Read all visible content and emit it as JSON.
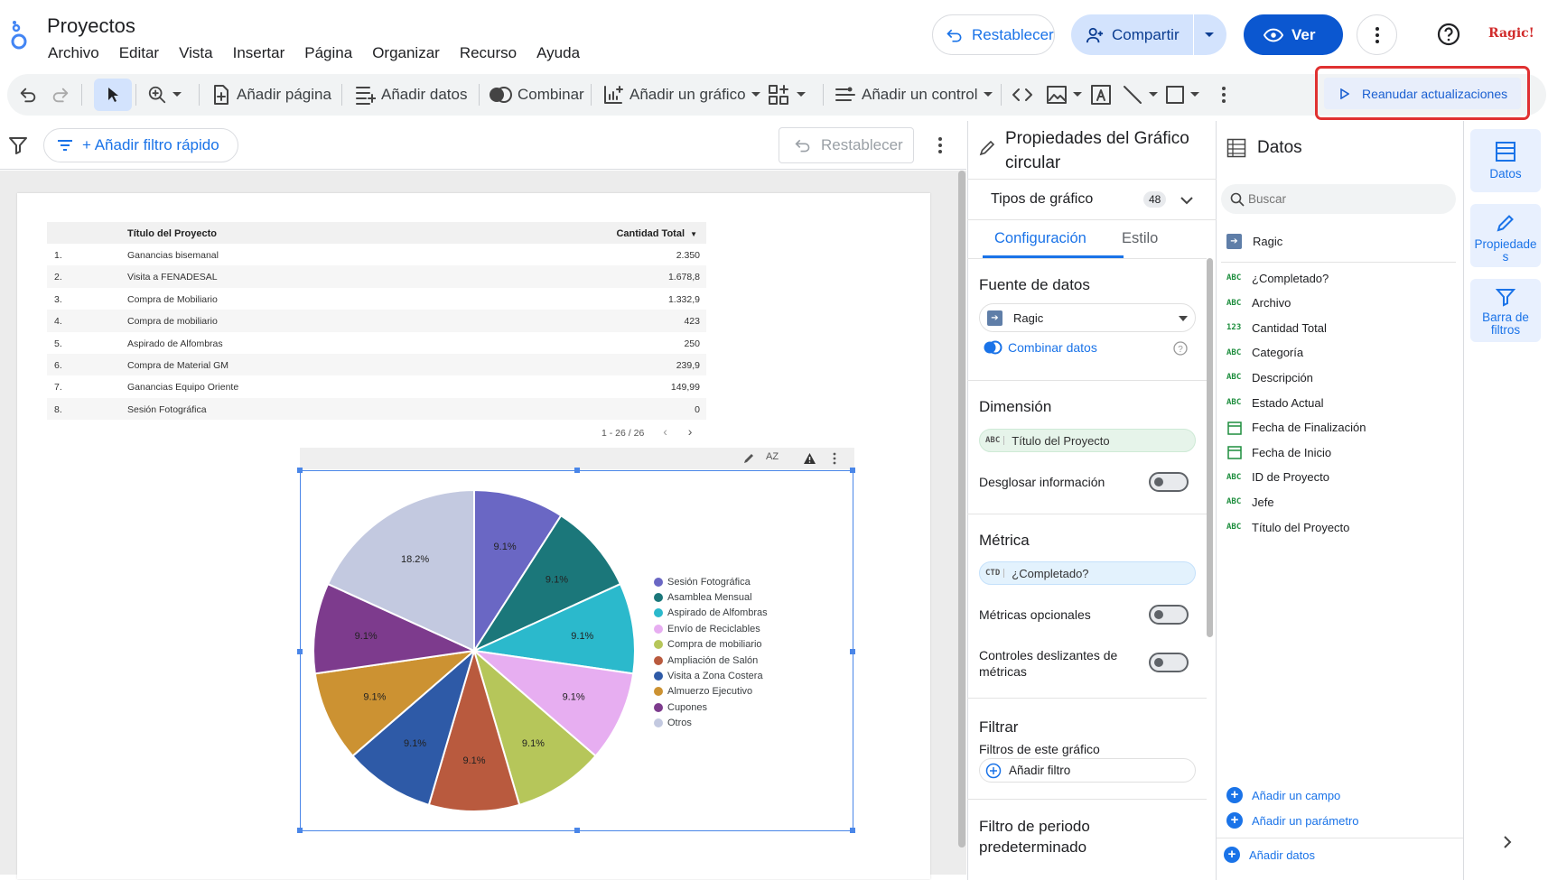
{
  "app": {
    "title": "Proyectos",
    "menu": [
      "Archivo",
      "Editar",
      "Vista",
      "Insertar",
      "Página",
      "Organizar",
      "Recurso",
      "Ayuda"
    ],
    "reset_label": "Restablecer",
    "share_label": "Compartir",
    "view_label": "Ver",
    "brand": "Ragic!"
  },
  "toolbar": {
    "add_page": "Añadir página",
    "add_data": "Añadir datos",
    "blend": "Combinar",
    "add_chart": "Añadir un gráfico",
    "add_control": "Añadir un control",
    "resume_updates": "Reanudar actualizaciones"
  },
  "filterbar": {
    "quick_filter": "+ Añadir filtro rápido",
    "reset": "Restablecer"
  },
  "table": {
    "headers": [
      "Título del Proyecto",
      "Cantidad Total"
    ],
    "rows": [
      {
        "n": "1.",
        "title": "Ganancias bisemanal",
        "value": "2.350"
      },
      {
        "n": "2.",
        "title": "Visita a FENADESAL",
        "value": "1.678,8"
      },
      {
        "n": "3.",
        "title": "Compra de Mobiliario",
        "value": "1.332,9"
      },
      {
        "n": "4.",
        "title": "Compra de mobiliario",
        "value": "423"
      },
      {
        "n": "5.",
        "title": "Aspirado de Alfombras",
        "value": "250"
      },
      {
        "n": "6.",
        "title": "Compra de Material GM",
        "value": "239,9"
      },
      {
        "n": "7.",
        "title": "Ganancias Equipo Oriente",
        "value": "149,99"
      },
      {
        "n": "8.",
        "title": "Sesión Fotográfica",
        "value": "0"
      }
    ],
    "pagination": "1 - 26 / 26"
  },
  "chart_data": {
    "type": "pie",
    "categories": [
      "Sesión Fotográfica",
      "Asamblea Mensual",
      "Aspirado de Alfombras",
      "Envío de Reciclables",
      "Compra de mobiliario",
      "Ampliación de Salón",
      "Visita a Zona Costera",
      "Almuerzo Ejecutivo",
      "Cupones",
      "Otros"
    ],
    "values": [
      9.1,
      9.1,
      9.1,
      9.1,
      9.1,
      9.1,
      9.1,
      9.1,
      9.1,
      18.2
    ],
    "labels": [
      "9.1%",
      "9.1%",
      "9.1%",
      "9.1%",
      "9.1%",
      "9.1%",
      "9.1%",
      "9.1%",
      "9.1%",
      "18.2%"
    ],
    "colors": [
      "#6a67c4",
      "#1b777a",
      "#2bb9cc",
      "#e7aef1",
      "#b6c65a",
      "#b95a3e",
      "#2e5aa7",
      "#cc9232",
      "#7d3b8d",
      "#c3c9e0"
    ],
    "legend_position": "right",
    "title": ""
  },
  "properties": {
    "title": "Propiedades del Gráfico circular",
    "chart_types_label": "Tipos de gráfico",
    "chart_types_count": "48",
    "tab_config": "Configuración",
    "tab_style": "Estilo",
    "data_source_title": "Fuente de datos",
    "data_source_value": "Ragic",
    "blend_data": "Combinar datos",
    "dimension_title": "Dimensión",
    "dimension_tag": "ABC",
    "dimension_value": "Título del Proyecto",
    "drill_down": "Desglosar información",
    "metric_title": "Métrica",
    "metric_tag": "CTD",
    "metric_value": "¿Completado?",
    "optional_metrics": "Métricas opcionales",
    "metric_sliders": "Controles deslizantes de métricas",
    "filter_title": "Filtrar",
    "filter_sub": "Filtros de este gráfico",
    "add_filter": "Añadir filtro",
    "date_filter_title": "Filtro de periodo predeterminado"
  },
  "data_panel": {
    "title": "Datos",
    "search_placeholder": "Buscar",
    "source": "Ragic",
    "fields": [
      {
        "type": "ABC",
        "name": "¿Completado?"
      },
      {
        "type": "ABC",
        "name": "Archivo"
      },
      {
        "type": "123",
        "name": "Cantidad Total"
      },
      {
        "type": "ABC",
        "name": "Categoría"
      },
      {
        "type": "ABC",
        "name": "Descripción"
      },
      {
        "type": "ABC",
        "name": "Estado Actual"
      },
      {
        "type": "date",
        "name": "Fecha de Finalización"
      },
      {
        "type": "date",
        "name": "Fecha de Inicio"
      },
      {
        "type": "ABC",
        "name": "ID de Proyecto"
      },
      {
        "type": "ABC",
        "name": "Jefe"
      },
      {
        "type": "ABC",
        "name": "Título del Proyecto"
      }
    ],
    "add_field": "Añadir un campo",
    "add_parameter": "Añadir un parámetro",
    "add_data": "Añadir datos"
  },
  "rail": {
    "data": "Datos",
    "properties": "Propiedades",
    "filter_bar": "Barra de filtros"
  }
}
